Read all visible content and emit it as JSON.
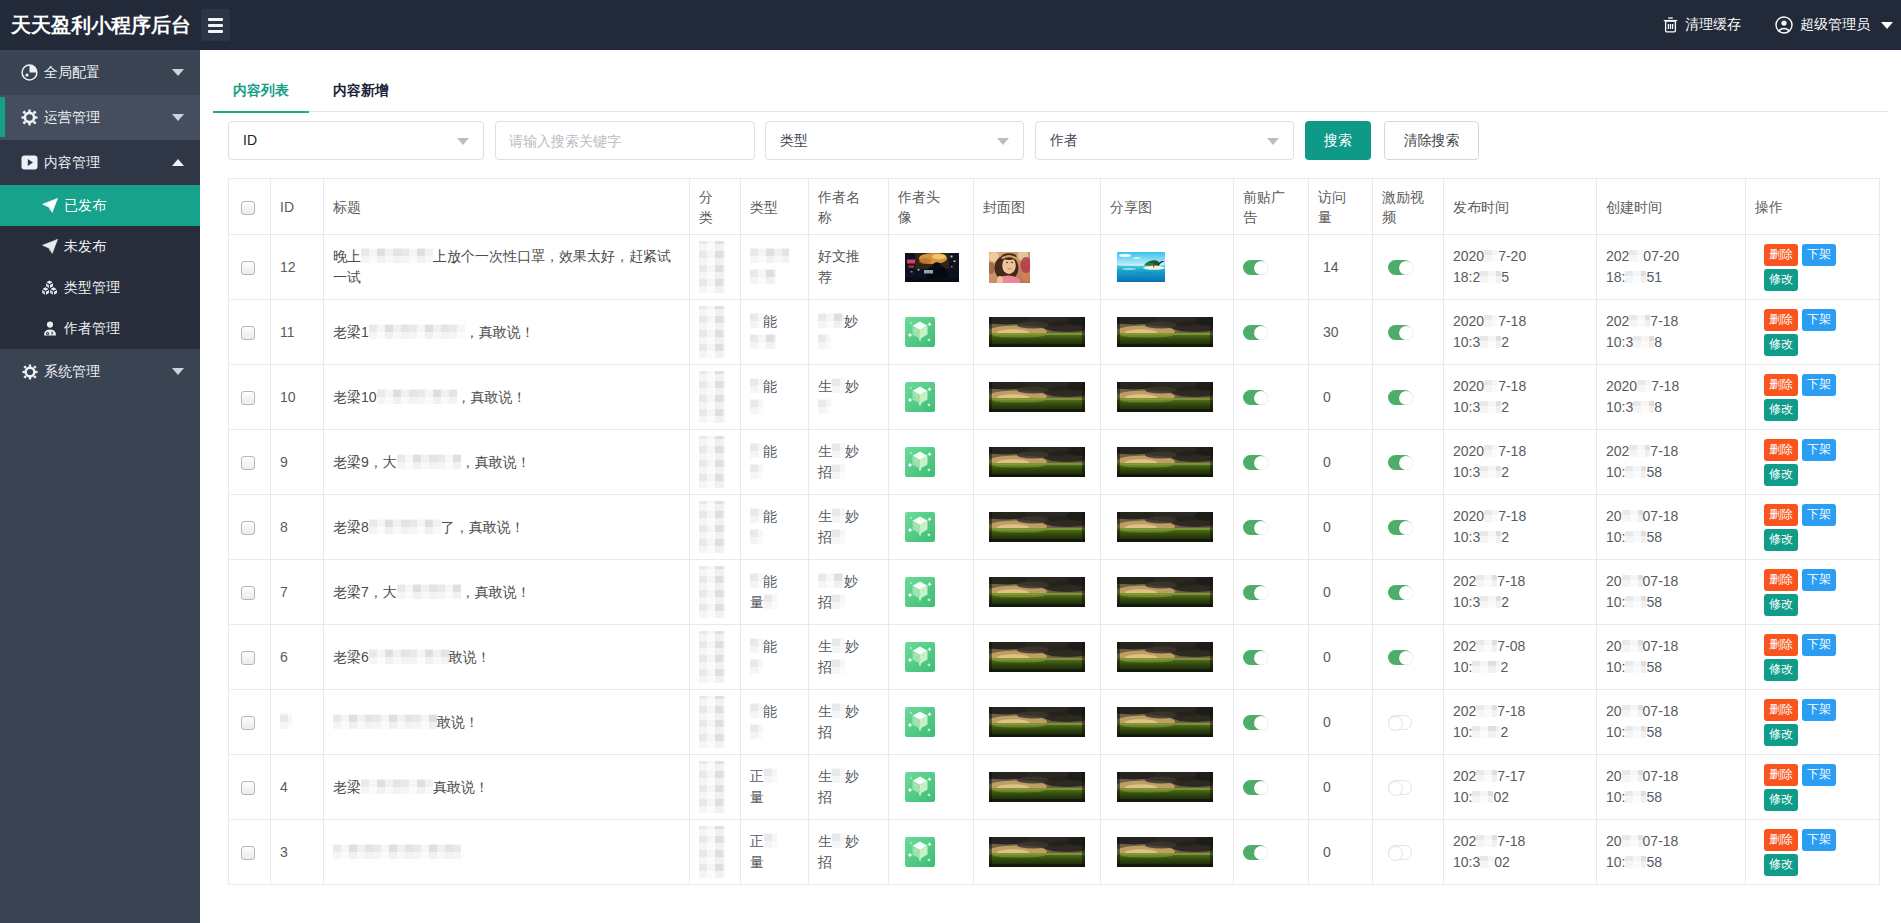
{
  "topbar": {
    "title": "天天盈利小程序后台",
    "clear_cache": "清理缓存",
    "admin_name": "超级管理员"
  },
  "sidebar": {
    "items": [
      {
        "label": "全局配置",
        "icon": "globe-icon",
        "state": "collapsed"
      },
      {
        "label": "运营管理",
        "icon": "gear-icon",
        "state": "collapsed-highlight"
      },
      {
        "label": "内容管理",
        "icon": "video-icon",
        "state": "expanded"
      }
    ],
    "submenu": [
      {
        "label": "已发布",
        "icon": "paper-plane-icon",
        "active": true
      },
      {
        "label": "未发布",
        "icon": "paper-plane-icon",
        "active": false
      },
      {
        "label": "类型管理",
        "icon": "cubes-icon",
        "active": false
      },
      {
        "label": "作者管理",
        "icon": "user-icon",
        "active": false
      }
    ],
    "bottom_items": [
      {
        "label": "系统管理",
        "icon": "gear-icon",
        "state": "collapsed"
      }
    ]
  },
  "tabs": [
    {
      "label": "内容列表",
      "active": true
    },
    {
      "label": "内容新增",
      "active": false
    }
  ],
  "filters": {
    "field_select": "ID",
    "keyword_placeholder": "请输入搜索关键字",
    "type_select": "类型",
    "author_select": "作者",
    "search_label": "搜索",
    "clear_label": "清除搜索"
  },
  "table": {
    "headers": [
      {
        "key": "checkbox",
        "lines": [
          ""
        ]
      },
      {
        "key": "id",
        "lines": [
          "ID"
        ]
      },
      {
        "key": "title",
        "lines": [
          "标题"
        ]
      },
      {
        "key": "category",
        "lines": [
          "分",
          "类"
        ]
      },
      {
        "key": "type",
        "lines": [
          "类型"
        ]
      },
      {
        "key": "author_name",
        "lines": [
          "作者名",
          "称"
        ]
      },
      {
        "key": "author_avatar",
        "lines": [
          "作者头",
          "像"
        ]
      },
      {
        "key": "cover_image",
        "lines": [
          "封面图"
        ]
      },
      {
        "key": "share_image",
        "lines": [
          "分享图"
        ]
      },
      {
        "key": "pre_ad",
        "lines": [
          "前贴广",
          "告"
        ]
      },
      {
        "key": "visits",
        "lines": [
          "访问",
          "量"
        ]
      },
      {
        "key": "reward_video",
        "lines": [
          "激励视",
          "频"
        ]
      },
      {
        "key": "publish_time",
        "lines": [
          "发布时间"
        ]
      },
      {
        "key": "create_time",
        "lines": [
          "创建时间"
        ]
      },
      {
        "key": "ops",
        "lines": [
          "操作"
        ]
      }
    ],
    "actions": {
      "delete": "删除",
      "unpublish": "下架",
      "edit": "修改"
    },
    "rows": [
      {
        "id": "12",
        "title": "晚上▓▓▓▓▓▓▓▓▓上放个一次性口罩，效果太好，赶紧试一试",
        "type_lines": [
          "▓▓▓",
          "▓▓"
        ],
        "author_lines": [
          "好文推",
          "荐"
        ],
        "avatar": "night",
        "cover": "woman",
        "share": "beach",
        "pre_ad": true,
        "visits": "14",
        "reward_video": true,
        "publish_time": [
          "2020▓▓7-20",
          "18:2▓▓▓5"
        ],
        "create_time": [
          "202▓▓07-20",
          "18:▓▓▓51"
        ]
      },
      {
        "id": "11",
        "title": "老梁1▓▓▓▓▓▓▓▓▓▓▓▓，真敢说！",
        "type_lines": [
          "▓能",
          "▓▓"
        ],
        "author_lines": [
          "▓▓妙",
          "▓"
        ],
        "avatar": "cube",
        "cover": "landscape",
        "share": "landscape",
        "pre_ad": true,
        "visits": "30",
        "reward_video": true,
        "publish_time": [
          "2020▓▓7-18",
          "10:3▓▓▓2"
        ],
        "create_time": [
          "202▓▓▓7-18",
          "10:3▓▓▓8"
        ]
      },
      {
        "id": "10",
        "title": "老梁10▓▓▓▓▓▓▓▓▓▓，真敢说！",
        "type_lines": [
          "▓能",
          "▓"
        ],
        "author_lines": [
          "生▓妙",
          "▓"
        ],
        "avatar": "cube",
        "cover": "landscape",
        "share": "landscape",
        "pre_ad": true,
        "visits": "0",
        "reward_video": true,
        "publish_time": [
          "2020▓▓7-18",
          "10:3▓▓▓2"
        ],
        "create_time": [
          "2020▓▓7-18",
          "10:3▓▓▓8"
        ]
      },
      {
        "id": "9",
        "title": "老梁9，大▓▓▓▓▓▓▓▓，真敢说！",
        "type_lines": [
          "▓能",
          "▓"
        ],
        "author_lines": [
          "生▓妙",
          "招▓"
        ],
        "avatar": "cube",
        "cover": "landscape",
        "share": "landscape",
        "pre_ad": true,
        "visits": "0",
        "reward_video": true,
        "publish_time": [
          "2020▓▓7-18",
          "10:3▓▓▓2"
        ],
        "create_time": [
          "202▓▓▓7-18",
          "10:▓▓▓58"
        ]
      },
      {
        "id": "8",
        "title": "老梁8▓▓▓▓▓▓▓▓▓了，真敢说！",
        "type_lines": [
          "▓能",
          "▓"
        ],
        "author_lines": [
          "生▓妙",
          "招▓"
        ],
        "avatar": "cube",
        "cover": "landscape",
        "share": "landscape",
        "pre_ad": true,
        "visits": "0",
        "reward_video": true,
        "publish_time": [
          "2020▓▓7-18",
          "10:3▓▓▓2"
        ],
        "create_time": [
          "20▓▓▓07-18",
          "10:▓▓▓58"
        ]
      },
      {
        "id": "7",
        "title": "老梁7，大▓▓▓▓▓▓▓▓，真敢说！",
        "type_lines": [
          "▓能",
          "量▓"
        ],
        "author_lines": [
          "▓▓妙",
          "招▓"
        ],
        "avatar": "cube",
        "cover": "landscape",
        "share": "landscape",
        "pre_ad": true,
        "visits": "0",
        "reward_video": true,
        "publish_time": [
          "202▓▓▓7-18",
          "10:3▓▓▓2"
        ],
        "create_time": [
          "20▓▓▓07-18",
          "10:▓▓▓58"
        ]
      },
      {
        "id": "6",
        "title": "老梁6▓▓▓▓▓▓▓▓▓▓敢说！",
        "type_lines": [
          "▓能",
          "▓"
        ],
        "author_lines": [
          "生▓妙",
          "招▓"
        ],
        "avatar": "cube",
        "cover": "landscape",
        "share": "landscape",
        "pre_ad": true,
        "visits": "0",
        "reward_video": true,
        "publish_time": [
          "202▓▓▓7-08",
          "10:▓▓▓▓2"
        ],
        "create_time": [
          "20▓▓▓07-18",
          "10:▓▓▓58"
        ]
      },
      {
        "id": "▓",
        "title": "▓▓▓▓▓▓▓▓▓▓▓▓▓敢说！",
        "type_lines": [
          "▓能",
          "▓"
        ],
        "author_lines": [
          "生▓妙",
          "招"
        ],
        "avatar": "cube",
        "cover": "landscape",
        "share": "landscape",
        "pre_ad": true,
        "visits": "0",
        "reward_video": false,
        "publish_time": [
          "202▓▓▓7-18",
          "10:▓▓▓▓2"
        ],
        "create_time": [
          "20▓▓▓07-18",
          "10:▓▓▓58"
        ]
      },
      {
        "id": "4",
        "title": "老梁▓▓▓▓▓▓▓▓▓真敢说！",
        "type_lines": [
          "正▓",
          "量"
        ],
        "author_lines": [
          "生▓妙",
          "招"
        ],
        "avatar": "cube",
        "cover": "landscape",
        "share": "landscape",
        "pre_ad": true,
        "visits": "0",
        "reward_video": false,
        "publish_time": [
          "202▓▓▓7-17",
          "10:▓▓▓02"
        ],
        "create_time": [
          "20▓▓▓07-18",
          "10:▓▓▓58"
        ]
      },
      {
        "id": "3",
        "title": "▓▓▓▓▓▓▓▓▓▓▓▓▓▓▓▓",
        "type_lines": [
          "正▓",
          "量"
        ],
        "author_lines": [
          "生▓妙",
          "招"
        ],
        "avatar": "cube",
        "cover": "landscape",
        "share": "landscape",
        "pre_ad": true,
        "visits": "0",
        "reward_video": false,
        "publish_time": [
          "202▓▓▓7-18",
          "10:3▓▓02"
        ],
        "create_time": [
          "20▓▓▓07-18",
          "10:▓▓▓58"
        ]
      }
    ]
  },
  "accent_colors": {
    "teal": "#0e9a87",
    "sidebar_active": "#17a28b",
    "toggle_on": "#4cae68",
    "delete_red": "#f9531e",
    "unpublish_blue": "#2b9ef3",
    "edit_teal": "#0f9d8a",
    "topbar_bg": "#222938",
    "sidebar_bg": "#3a4352"
  }
}
